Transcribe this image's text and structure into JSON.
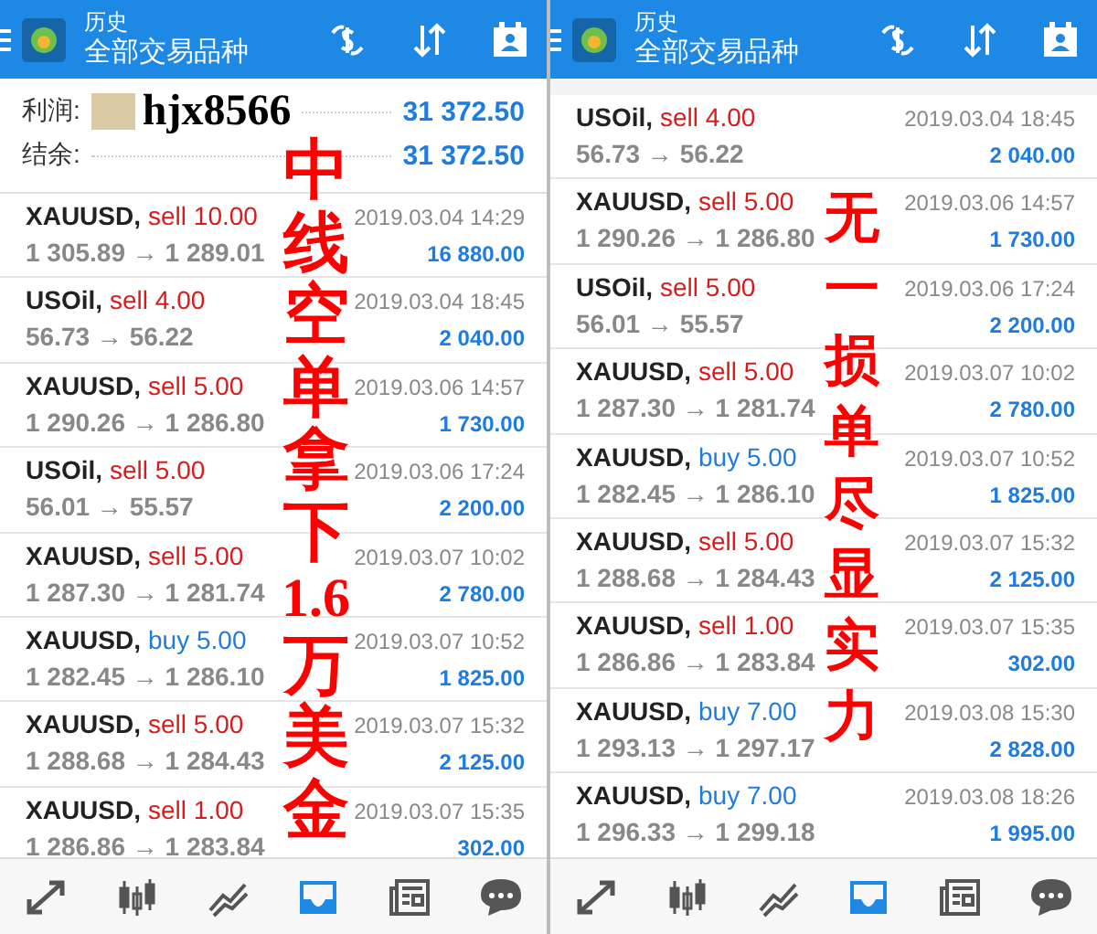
{
  "panels": [
    {
      "header": {
        "title": "历史",
        "subtitle": "全部交易品种"
      },
      "summary": [
        {
          "label": "利润:",
          "value": "31 372.50",
          "tag": "hjx8566"
        },
        {
          "label": "结余:",
          "value": "31 372.50"
        }
      ],
      "cut_top": false,
      "trades": [
        {
          "symbol": "XAUUSD,",
          "side": "sell",
          "volume": "10.00",
          "prices": "1 305.89 → 1 289.01",
          "time": "2019.03.04 14:29",
          "profit": "16 880.00"
        },
        {
          "symbol": "USOil,",
          "side": "sell",
          "volume": "4.00",
          "prices": "56.73 → 56.22",
          "time": "2019.03.04 18:45",
          "profit": "2 040.00"
        },
        {
          "symbol": "XAUUSD,",
          "side": "sell",
          "volume": "5.00",
          "prices": "1 290.26 → 1 286.80",
          "time": "2019.03.06 14:57",
          "profit": "1 730.00"
        },
        {
          "symbol": "USOil,",
          "side": "sell",
          "volume": "5.00",
          "prices": "56.01 → 55.57",
          "time": "2019.03.06 17:24",
          "profit": "2 200.00"
        },
        {
          "symbol": "XAUUSD,",
          "side": "sell",
          "volume": "5.00",
          "prices": "1 287.30 → 1 281.74",
          "time": "2019.03.07 10:02",
          "profit": "2 780.00"
        },
        {
          "symbol": "XAUUSD,",
          "side": "buy",
          "volume": "5.00",
          "prices": "1 282.45 → 1 286.10",
          "time": "2019.03.07 10:52",
          "profit": "1 825.00"
        },
        {
          "symbol": "XAUUSD,",
          "side": "sell",
          "volume": "5.00",
          "prices": "1 288.68 → 1 284.43",
          "time": "2019.03.07 15:32",
          "profit": "2 125.00"
        },
        {
          "symbol": "XAUUSD,",
          "side": "sell",
          "volume": "1.00",
          "prices": "1 286.86 → 1 283.84",
          "time": "2019.03.07 15:35",
          "profit": "302.00"
        }
      ],
      "overlay": [
        "中线空单拿下",
        "1.6",
        "万美金"
      ],
      "nav": [
        {
          "selected": false
        },
        {
          "selected": false
        },
        {
          "selected": false
        },
        {
          "selected": true
        },
        {
          "selected": false
        },
        {
          "selected": false
        }
      ]
    },
    {
      "header": {
        "title": "历史",
        "subtitle": "全部交易品种"
      },
      "cut_top": true,
      "trades": [
        {
          "symbol": "USOil,",
          "side": "sell",
          "volume": "4.00",
          "prices": "56.73 → 56.22",
          "time": "2019.03.04 18:45",
          "profit": "2 040.00"
        },
        {
          "symbol": "XAUUSD,",
          "side": "sell",
          "volume": "5.00",
          "prices": "1 290.26 → 1 286.80",
          "time": "2019.03.06 14:57",
          "profit": "1 730.00"
        },
        {
          "symbol": "USOil,",
          "side": "sell",
          "volume": "5.00",
          "prices": "56.01 → 55.57",
          "time": "2019.03.06 17:24",
          "profit": "2 200.00"
        },
        {
          "symbol": "XAUUSD,",
          "side": "sell",
          "volume": "5.00",
          "prices": "1 287.30 → 1 281.74",
          "time": "2019.03.07 10:02",
          "profit": "2 780.00"
        },
        {
          "symbol": "XAUUSD,",
          "side": "buy",
          "volume": "5.00",
          "prices": "1 282.45 → 1 286.10",
          "time": "2019.03.07 10:52",
          "profit": "1 825.00"
        },
        {
          "symbol": "XAUUSD,",
          "side": "sell",
          "volume": "5.00",
          "prices": "1 288.68 → 1 284.43",
          "time": "2019.03.07 15:32",
          "profit": "2 125.00"
        },
        {
          "symbol": "XAUUSD,",
          "side": "sell",
          "volume": "1.00",
          "prices": "1 286.86 → 1 283.84",
          "time": "2019.03.07 15:35",
          "profit": "302.00"
        },
        {
          "symbol": "XAUUSD,",
          "side": "buy",
          "volume": "7.00",
          "prices": "1 293.13 → 1 297.17",
          "time": "2019.03.08 15:30",
          "profit": "2 828.00"
        },
        {
          "symbol": "XAUUSD,",
          "side": "buy",
          "volume": "7.00",
          "prices": "1 296.33 → 1 299.18",
          "time": "2019.03.08 18:26",
          "profit": "1 995.00"
        }
      ],
      "overlay": [
        "无一损单尽显实力"
      ],
      "nav": [
        {
          "selected": false
        },
        {
          "selected": false
        },
        {
          "selected": false
        },
        {
          "selected": true
        },
        {
          "selected": false
        },
        {
          "selected": false
        }
      ]
    }
  ]
}
